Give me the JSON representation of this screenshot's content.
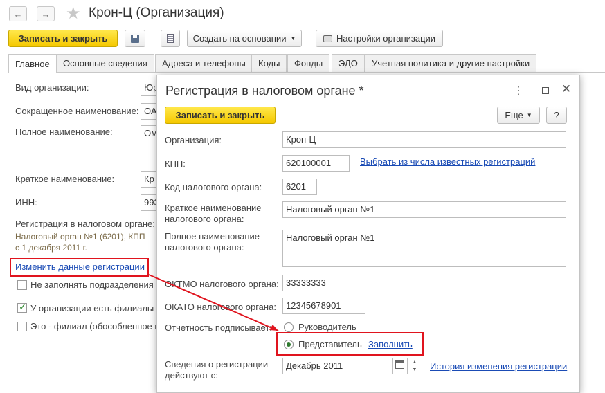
{
  "window": {
    "title": "Крон-Ц (Организация)"
  },
  "toolbar": {
    "save_close": "Записать и закрыть",
    "create_based": "Создать на основании",
    "org_settings": "Настройки организации"
  },
  "tabs": [
    "Главное",
    "Основные сведения",
    "Адреса и телефоны",
    "Коды",
    "Фонды",
    "ЭДО",
    "Учетная политика и другие настройки"
  ],
  "main": {
    "kind_label": "Вид организации:",
    "kind_value": "Юр",
    "short_name_label": "Сокращенное наименование:",
    "short_name_value": "ОА",
    "full_name_label": "Полное наименование:",
    "full_name_value": "Ом",
    "brief_label": "Краткое наименование:",
    "brief_value": "Кр",
    "inn_label": "ИНН:",
    "inn_value": "993",
    "reg_label": "Регистрация в налоговом органе:",
    "reg_line1": "Налоговый орган №1 (6201), КПП",
    "reg_line2": "с 1 декабря 2011 г.",
    "change_reg_link": "Изменить данные регистрации",
    "chk_no_fill": "Не заполнять подразделения",
    "chk_branches": "У организации есть филиалы (",
    "chk_is_branch": "Это - филиал (обособленное по"
  },
  "dialog": {
    "title": "Регистрация в налоговом органе *",
    "save_close": "Записать и закрыть",
    "more": "Еще",
    "help": "?",
    "org_label": "Организация:",
    "org_value": "Крон-Ц",
    "kpp_label": "КПП:",
    "kpp_value": "620100001",
    "kpp_link": "Выбрать из числа известных регистраций",
    "code_label": "Код налогового органа:",
    "code_value": "6201",
    "brief_label_1": "Краткое наименование",
    "brief_label_2": "налогового органа:",
    "brief_value": "Налоговый орган №1",
    "full_label_1": "Полное наименование",
    "full_label_2": "налогового органа:",
    "full_value": "Налоговый орган №1",
    "oktmo_label": "ОКТМО налогового органа:",
    "oktmo_value": "33333333",
    "okato_label": "ОКАТО налогового органа:",
    "okato_value": "12345678901",
    "signer_label": "Отчетность подписывает:",
    "signer_head": "Руководитель",
    "signer_rep": "Представитель",
    "fill_link": "Заполнить",
    "valid_label_1": "Сведения о регистрации",
    "valid_label_2": "действуют с:",
    "valid_value": "Декабрь 2011",
    "history_link": "История изменения регистрации"
  },
  "colors": {
    "accent_yellow": "#f5c800",
    "link_blue": "#1a4bb5",
    "highlight_red": "#e0141e"
  }
}
